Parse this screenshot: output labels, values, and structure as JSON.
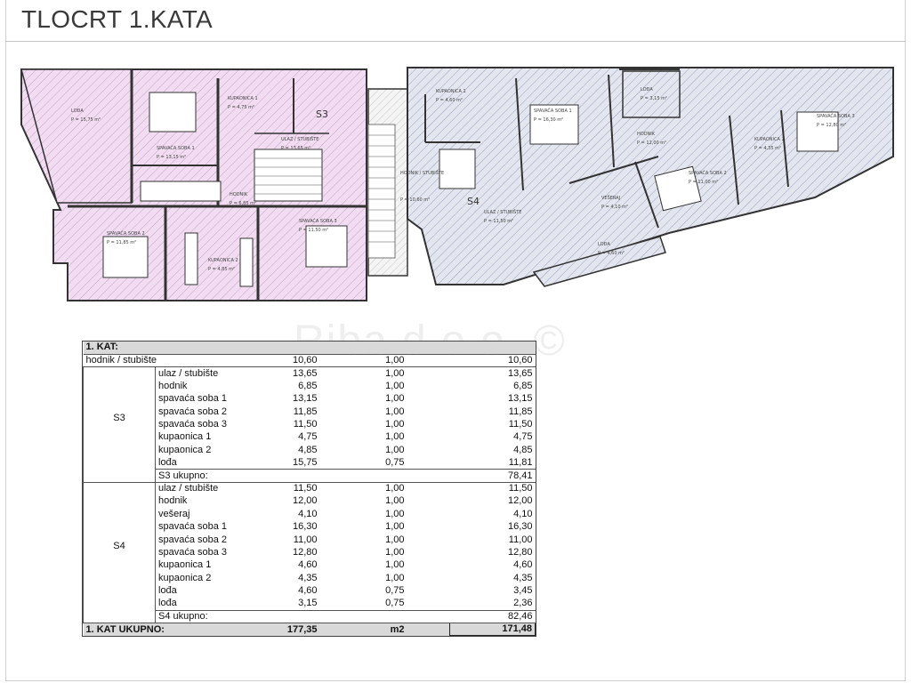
{
  "title": "TLOCRT 1.KATA",
  "watermark": "Riba d.o.o. ©",
  "plan": {
    "s3_label": "S3",
    "s4_label": "S4",
    "s3_rooms": [
      {
        "name": "LOĐA",
        "area": "P = 15,75 m²"
      },
      {
        "name": "SPAVAĆA SOBA 1",
        "area": "P = 13,15 m²"
      },
      {
        "name": "KUPAONICA 1",
        "area": "P = 4,75 m²"
      },
      {
        "name": "ULAZ / STUBIŠTE",
        "area": "P = 13,65 m²"
      },
      {
        "name": "HODNIK",
        "area": "P = 6,85 m²"
      },
      {
        "name": "SPAVAĆA SOBA 2",
        "area": "P = 11,85 m²"
      },
      {
        "name": "KUPAONICA 2",
        "area": "P = 4,85 m²"
      },
      {
        "name": "SPAVAĆA SOBA 3",
        "area": "P = 11,50 m²"
      }
    ],
    "common": {
      "name": "HODNIK / STUBIŠTE",
      "area": "P = 10,60 m²"
    },
    "s4_rooms": [
      {
        "name": "KUPAONICA 1",
        "area": "P = 4,60 m²"
      },
      {
        "name": "SPAVAĆA SOBA 1",
        "area": "P = 16,30 m²"
      },
      {
        "name": "LOĐA",
        "area": "P = 3,15 m²"
      },
      {
        "name": "HODNIK",
        "area": "P = 12,00 m²"
      },
      {
        "name": "KUPAONICA 2",
        "area": "P = 4,35 m²"
      },
      {
        "name": "SPAVAĆA SOBA 3",
        "area": "P = 12,80 m²"
      },
      {
        "name": "ULAZ / STUBIŠTE",
        "area": "P = 11,50 m²"
      },
      {
        "name": "VEŠERAJ",
        "area": "P = 4,10 m²"
      },
      {
        "name": "SPAVAĆA SOBA 2",
        "area": "P = 11,00 m²"
      },
      {
        "name": "LOĐA",
        "area": "P = 4,60 m²"
      }
    ]
  },
  "table": {
    "header": "1. KAT:",
    "common_row": {
      "room": "hodnik / stubište",
      "area": "10,60",
      "coef": "1,00",
      "net": "10,60"
    },
    "units": [
      {
        "name": "S3",
        "rows": [
          {
            "room": "ulaz / stubište",
            "area": "13,65",
            "coef": "1,00",
            "net": "13,65"
          },
          {
            "room": "hodnik",
            "area": "6,85",
            "coef": "1,00",
            "net": "6,85"
          },
          {
            "room": "spavaća soba 1",
            "area": "13,15",
            "coef": "1,00",
            "net": "13,15"
          },
          {
            "room": "spavaća soba 2",
            "area": "11,85",
            "coef": "1,00",
            "net": "11,85"
          },
          {
            "room": "spavaća soba 3",
            "area": "11,50",
            "coef": "1,00",
            "net": "11,50"
          },
          {
            "room": "kupaonica 1",
            "area": "4,75",
            "coef": "1,00",
            "net": "4,75"
          },
          {
            "room": "kupaonica 2",
            "area": "4,85",
            "coef": "1,00",
            "net": "4,85"
          },
          {
            "room": "lođa",
            "area": "15,75",
            "coef": "0,75",
            "net": "11,81"
          }
        ],
        "subtotal_label": "S3 ukupno:",
        "subtotal": "78,41"
      },
      {
        "name": "S4",
        "rows": [
          {
            "room": "ulaz / stubište",
            "area": "11,50",
            "coef": "1,00",
            "net": "11,50"
          },
          {
            "room": "hodnik",
            "area": "12,00",
            "coef": "1,00",
            "net": "12,00"
          },
          {
            "room": "vešeraj",
            "area": "4,10",
            "coef": "1,00",
            "net": "4,10"
          },
          {
            "room": "spavaća soba 1",
            "area": "16,30",
            "coef": "1,00",
            "net": "16,30"
          },
          {
            "room": "spavaća soba 2",
            "area": "11,00",
            "coef": "1,00",
            "net": "11,00"
          },
          {
            "room": "spavaća soba 3",
            "area": "12,80",
            "coef": "1,00",
            "net": "12,80"
          },
          {
            "room": "kupaonica 1",
            "area": "4,60",
            "coef": "1,00",
            "net": "4,60"
          },
          {
            "room": "kupaonica 2",
            "area": "4,35",
            "coef": "1,00",
            "net": "4,35"
          },
          {
            "room": "lođa",
            "area": "4,60",
            "coef": "0,75",
            "net": "3,45"
          },
          {
            "room": "lođa",
            "area": "3,15",
            "coef": "0,75",
            "net": "2,36"
          }
        ],
        "subtotal_label": "S4 ukupno:",
        "subtotal": "82,46"
      }
    ],
    "total": {
      "label": "1. KAT UKUPNO:",
      "gross": "177,35",
      "unit": "m2",
      "net": "171,48"
    }
  },
  "colors": {
    "s3_fill": "#f1dcf1",
    "s3_hatch": "#c9a3c9",
    "s4_fill": "#e3e6ef",
    "s4_hatch": "#9ba3bd",
    "wall": "#333333",
    "table_header": "#d9d9d9"
  }
}
